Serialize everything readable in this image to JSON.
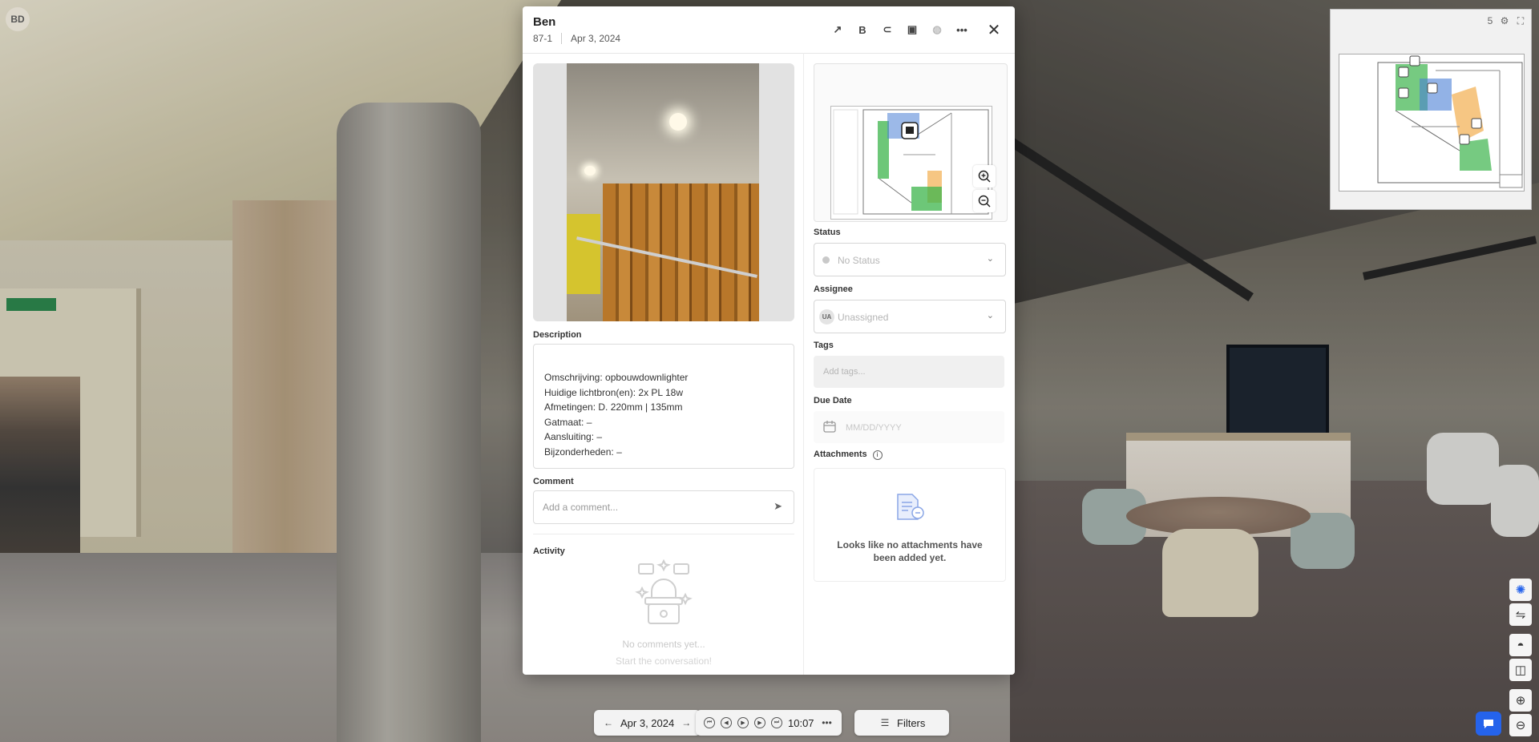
{
  "user": {
    "initials": "BD"
  },
  "modal": {
    "title": "Ben",
    "id": "87-1",
    "date": "Apr 3, 2024",
    "header_icons": [
      "share-icon",
      "bold-b-icon",
      "link-icon",
      "stop-square-icon",
      "globe-icon",
      "more-icon",
      "close-icon"
    ],
    "description": {
      "label": "Description",
      "lines": [
        "Omschrijving: opbouwdownlighter",
        "Huidige lichtbron(en): 2x PL 18w",
        "Afmetingen: D. 220mm | 135mm",
        "Gatmaat: –",
        "Aansluiting: –",
        "Bijzonderheden: –"
      ]
    },
    "comment": {
      "label": "Comment",
      "placeholder": "Add a comment..."
    },
    "activity": {
      "label": "Activity",
      "empty_title": "No comments yet...",
      "empty_sub": "Start the conversation!"
    },
    "status": {
      "label": "Status",
      "value": "No Status"
    },
    "assignee": {
      "label": "Assignee",
      "initials": "UA",
      "value": "Unassigned"
    },
    "tags": {
      "label": "Tags",
      "placeholder": "Add tags..."
    },
    "due_date": {
      "label": "Due Date",
      "placeholder": "MM/DD/YYYY"
    },
    "attachments": {
      "label": "Attachments",
      "empty": "Looks like no attachments have been added yet."
    }
  },
  "bottom_bar": {
    "date": "Apr 3, 2024",
    "time": "10:07",
    "filters": "Filters"
  },
  "minimap": {
    "sheet_label": "5"
  },
  "colors": {
    "accent": "#2563eb",
    "plan_green": "#3cb44b",
    "plan_orange": "#f0a030",
    "plan_blue": "#4a7fd6"
  }
}
